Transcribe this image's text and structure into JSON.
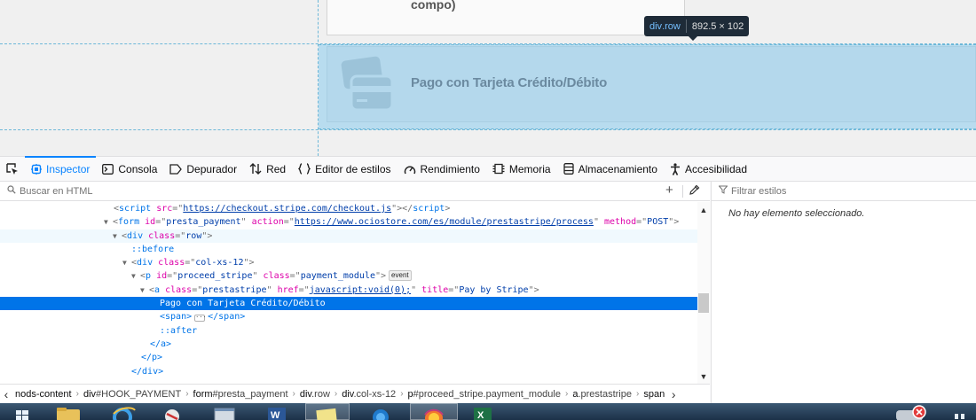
{
  "page_preview": {
    "previous_option_text": "compo)",
    "payment_option_label": "Pago con Tarjeta Crédito/Débito",
    "tooltip": {
      "tag": "div",
      "class_suffix": ".row",
      "dimensions": "892.5 × 102"
    }
  },
  "toolbar": {
    "tabs": [
      {
        "label": "Inspector",
        "icon": "inspector-icon"
      },
      {
        "label": "Consola",
        "icon": "console-icon"
      },
      {
        "label": "Depurador",
        "icon": "debugger-icon"
      },
      {
        "label": "Red",
        "icon": "network-icon"
      },
      {
        "label": "Editor de estilos",
        "icon": "style-editor-icon"
      },
      {
        "label": "Rendimiento",
        "icon": "performance-icon"
      },
      {
        "label": "Memoria",
        "icon": "memory-icon"
      },
      {
        "label": "Almacenamiento",
        "icon": "storage-icon"
      },
      {
        "label": "Accesibilidad",
        "icon": "accessibility-icon"
      }
    ],
    "selected_tab": "Inspector"
  },
  "search": {
    "placeholder": "Buscar en HTML"
  },
  "rules": {
    "filter_placeholder": "Filtrar estilos",
    "empty_message": "No hay elemento seleccionado."
  },
  "markup": {
    "script_tag": "script",
    "script_src_attr": "src",
    "script_src": "https://checkout.stripe.com/checkout.js",
    "form_tag": "form",
    "form_id_attr": "id",
    "form_id": "presta_payment",
    "form_action_attr": "action",
    "form_action": "https://www.ociostore.com/es/module/prestastripe/process",
    "form_method_attr": "method",
    "form_method": "POST",
    "row_tag": "div",
    "row_class_attr": "class",
    "row_class": "row",
    "before_pseudo": "::before",
    "col_tag": "div",
    "col_class_attr": "class",
    "col_class": "col-xs-12",
    "p_tag": "p",
    "p_id_attr": "id",
    "p_id": "proceed_stripe",
    "p_class_attr": "class",
    "p_class": "payment_module",
    "event_badge": "event",
    "a_tag": "a",
    "a_class_attr": "class",
    "a_class": "prestastripe",
    "a_href_attr": "href",
    "a_href": "javascript:void(0);",
    "a_title_attr": "title",
    "a_title": "Pay by Stripe",
    "selected_text": "Pago con Tarjeta Crédito/Débito",
    "span_open": "<span>",
    "span_close": "</span>",
    "after_pseudo": "::after",
    "a_close": "</a>",
    "p_close": "</p>",
    "div_close": "</div>"
  },
  "breadcrumb": [
    {
      "tag": "nods-content",
      "suffix": ""
    },
    {
      "tag": "div",
      "suffix": "#HOOK_PAYMENT"
    },
    {
      "tag": "form",
      "suffix": "#presta_payment"
    },
    {
      "tag": "div",
      "suffix": ".row"
    },
    {
      "tag": "div",
      "suffix": ".col-xs-12"
    },
    {
      "tag": "p",
      "suffix": "#proceed_stripe.payment_module"
    },
    {
      "tag": "a",
      "suffix": ".prestastripe"
    },
    {
      "tag": "span",
      "suffix": ""
    }
  ],
  "colors": {
    "accent": "#0a84ff",
    "selection": "#0074e8",
    "highlight": "#b8dcef",
    "tooltip_bg": "#1e2b38"
  }
}
